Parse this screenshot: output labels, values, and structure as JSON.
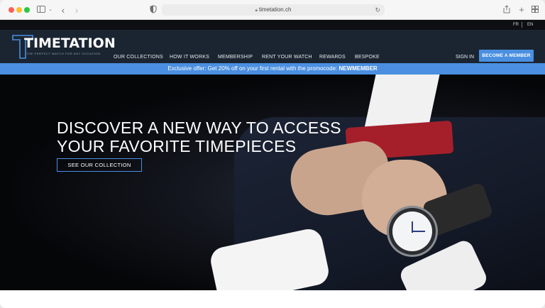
{
  "browser": {
    "url": "timetation.ch"
  },
  "site": {
    "languages": [
      "FR",
      "EN"
    ],
    "logo": {
      "wordmark": "TIMETATION",
      "tagline": "THE PERFECT WATCH FOR ANY OCCASION"
    },
    "nav": {
      "items": [
        {
          "label": "OUR COLLECTIONS"
        },
        {
          "label": "HOW IT WORKS"
        },
        {
          "label": "MEMBERSHIP"
        },
        {
          "label": "RENT YOUR WATCH"
        },
        {
          "label": "REWARDS"
        },
        {
          "label": "BESPOKE"
        }
      ],
      "sign_in": "SIGN IN",
      "become_member": "BECOME A MEMBER"
    },
    "promo": {
      "text": "Exclusive offer: Get 20% off on your first rental with the promocode: ",
      "code": "NEWMEMBER"
    },
    "hero": {
      "title_line1": "DISCOVER A NEW WAY TO ACCESS",
      "title_line2": "YOUR FAVORITE TIMEPIECES",
      "cta": "SEE OUR COLLECTION"
    }
  },
  "colors": {
    "accent": "#4a8fe0",
    "navbar": "#1b2531",
    "topbar": "#0d0f12"
  }
}
